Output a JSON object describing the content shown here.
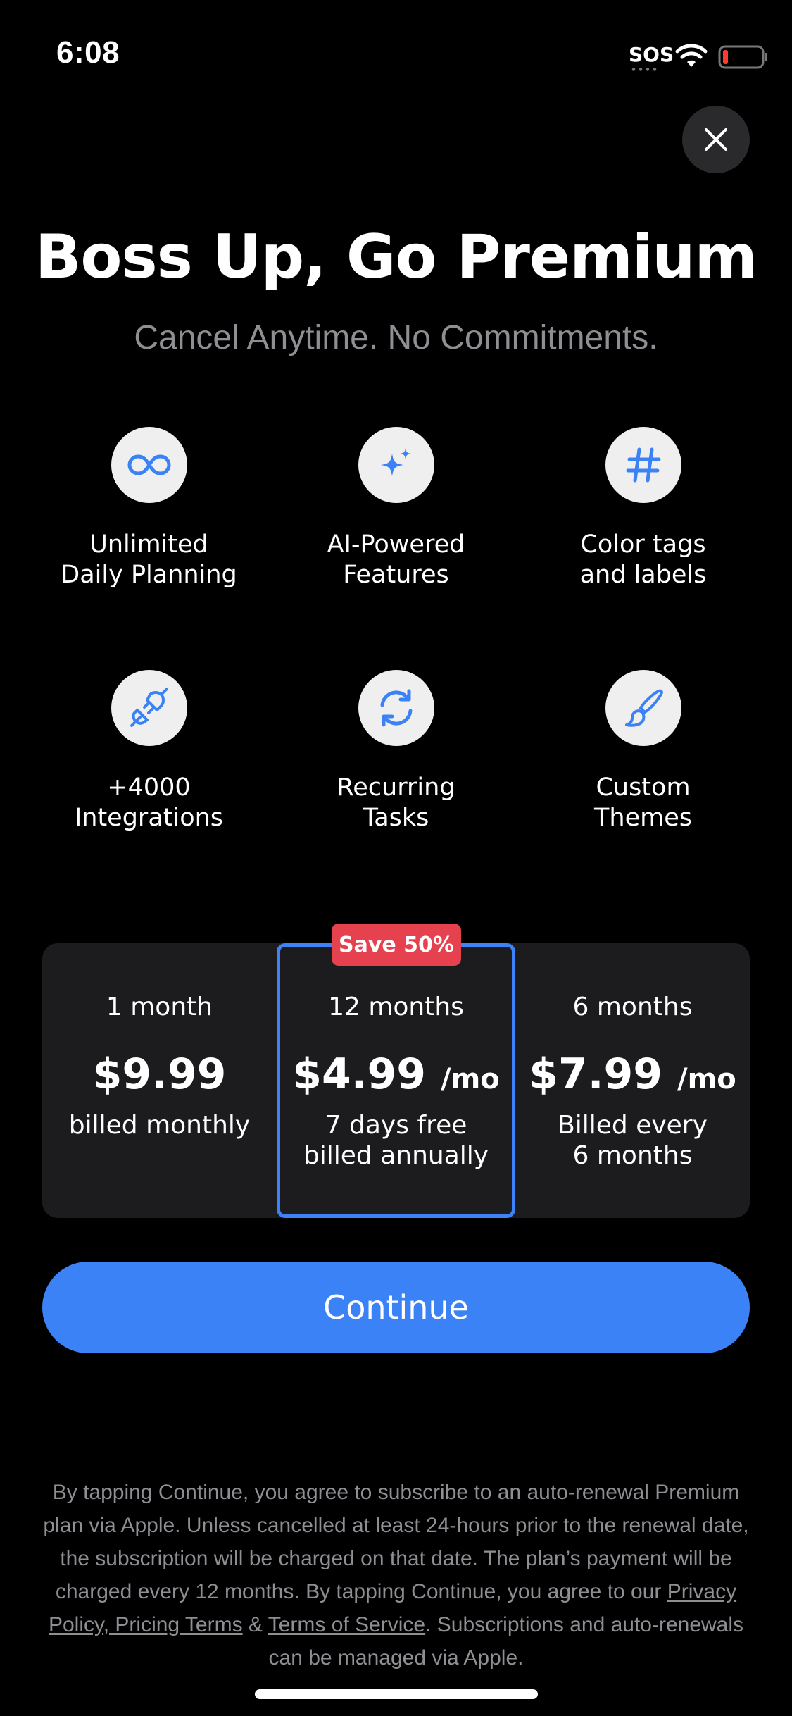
{
  "status_bar": {
    "time": "6:08",
    "sos": "SOS"
  },
  "header": {
    "title": "Boss Up, Go Premium",
    "subtitle": "Cancel Anytime. No Commitments."
  },
  "features": [
    {
      "icon": "infinity-icon",
      "label": "Unlimited\nDaily Planning"
    },
    {
      "icon": "sparkles-icon",
      "label": "AI-Powered\nFeatures"
    },
    {
      "icon": "hashtag-icon",
      "label": "Color tags\nand labels"
    },
    {
      "icon": "plug-icon",
      "label": "+4000\nIntegrations"
    },
    {
      "icon": "refresh-icon",
      "label": "Recurring\nTasks"
    },
    {
      "icon": "paintbrush-icon",
      "label": "Custom\nThemes"
    }
  ],
  "plans": {
    "badge": "Save 50%",
    "items": [
      {
        "duration": "1 month",
        "price": "$9.99",
        "unit": "",
        "note": "billed monthly"
      },
      {
        "duration": "12 months",
        "price": "$4.99",
        "unit": "/mo",
        "note": "7 days free\nbilled annually",
        "selected": true
      },
      {
        "duration": "6 months",
        "price": "$7.99",
        "unit": "/mo",
        "note": "Billed every\n6 months"
      }
    ]
  },
  "continue_label": "Continue",
  "legal": {
    "text_1": "By tapping Continue, you agree to subscribe to an auto-renewal Premium plan via Apple. Unless cancelled at least 24-hours prior to the renewal date, the subscription will be charged on that date. The plan’s payment will be charged every 12 months. By tapping Continue, you agree to our ",
    "privacy_link": "Privacy Policy, Pricing Terms",
    "amp": " & ",
    "tos_link": "Terms of Service",
    "text_2": ". Subscriptions and auto-renewals can be managed via Apple."
  },
  "colors": {
    "accent": "#3b82f6",
    "badge": "#e5414f",
    "background": "#000000",
    "card": "#1c1c1e"
  }
}
